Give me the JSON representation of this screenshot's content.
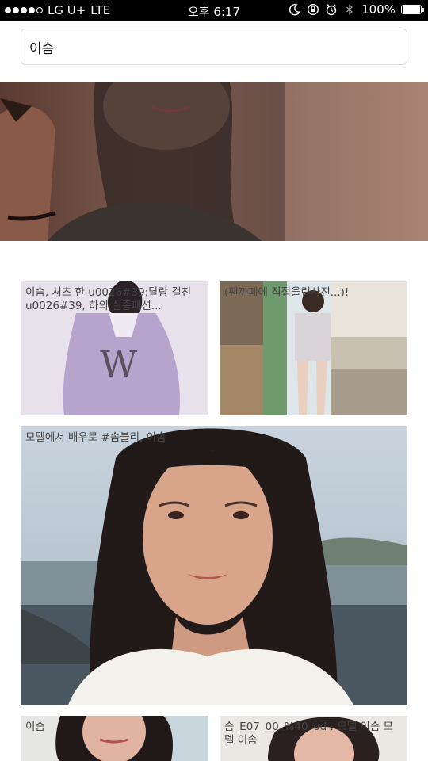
{
  "status_bar": {
    "carrier": "LG U+",
    "network": "LTE",
    "time": "오후 6:17",
    "battery": "100%",
    "battery_level": 1.0
  },
  "search": {
    "value": "이솜"
  },
  "results": [
    {
      "caption": ""
    },
    {
      "caption": "이솜, 셔츠 한 u0026#39;달랑 걸친u0026#39, 하의 실종패션..."
    },
    {
      "caption": "(팬까페에 직접올린사진...)!"
    },
    {
      "caption": "모델에서 배우로 #솜블리, 이솜"
    },
    {
      "caption": "이솜"
    },
    {
      "caption": "솜_E07_00_%40_od : 모델 이솜 모델 이솜"
    }
  ],
  "colors": {
    "status_bar_bg": "#000000",
    "page_bg": "#ffffff",
    "search_border": "#dcdcdc"
  }
}
